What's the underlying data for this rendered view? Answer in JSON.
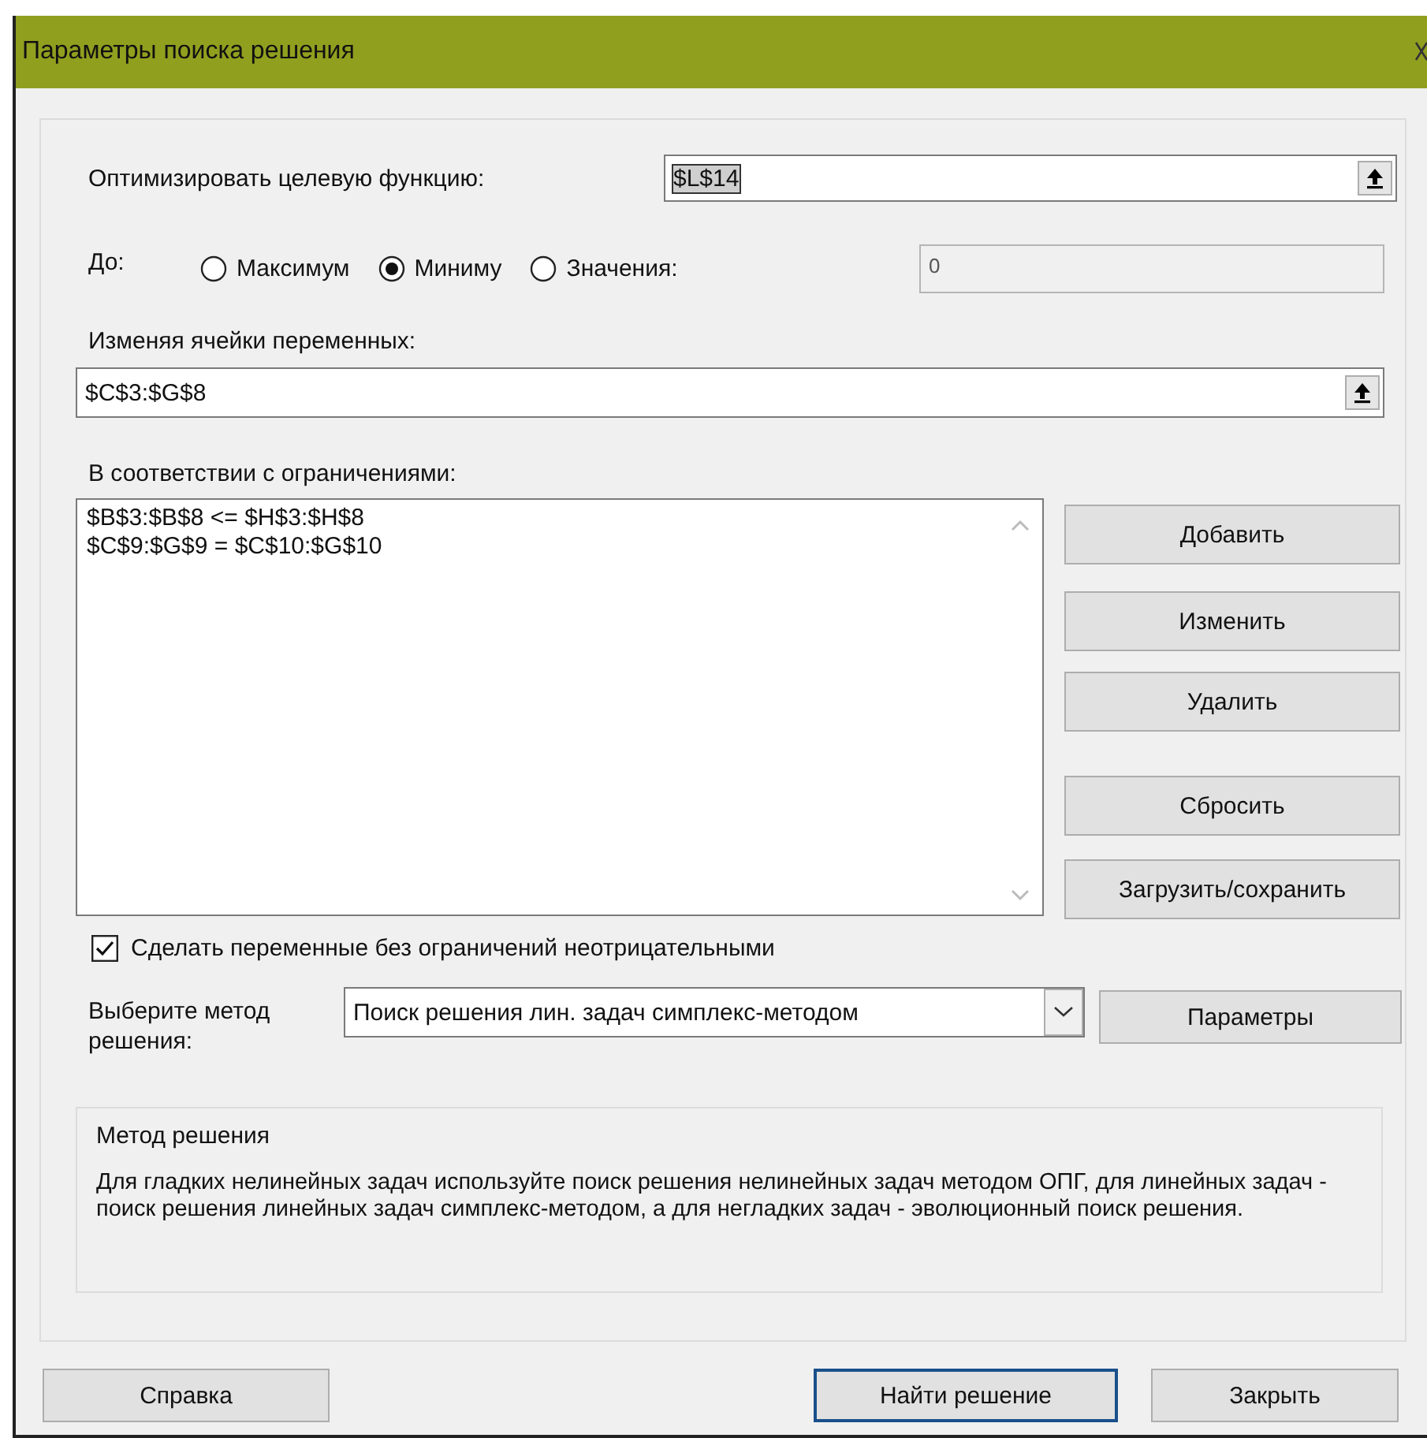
{
  "window": {
    "title": "Параметры поиска решения"
  },
  "objective": {
    "label": "Оптимизировать целевую функцию:",
    "value": "$L$14",
    "selected_text": true
  },
  "target": {
    "label": "До:",
    "options": [
      {
        "label": "Максимум",
        "selected": false
      },
      {
        "label": "Миниму",
        "selected": true
      },
      {
        "label": "Значения:",
        "selected": false
      }
    ],
    "value_field": {
      "value": "0",
      "disabled": true
    }
  },
  "variables": {
    "label": "Изменяя ячейки переменных:",
    "value": "$C$3:$G$8"
  },
  "constraints": {
    "label": "В соответствии с ограничениями:",
    "items": [
      "$B$3:$B$8 <= $H$3:$H$8",
      "$C$9:$G$9 = $C$10:$G$10"
    ]
  },
  "constraint_buttons": [
    {
      "label": "Добавить"
    },
    {
      "label": "Изменить"
    },
    {
      "label": "Удалить"
    },
    {
      "label": "Сбросить"
    },
    {
      "label": "Загрузить/сохранить"
    }
  ],
  "nonnegative": {
    "label": "Сделать переменные без ограничений неотрицательными",
    "checked": true
  },
  "method": {
    "label": "Выберите метод решения:",
    "value": "Поиск решения лин. задач симплекс-методом",
    "button": "Параметры"
  },
  "method_info": {
    "title": "Метод решения",
    "text": "Для гладких нелинейных задач используйте поиск решения нелинейных задач методом ОПГ, для линейных задач - поиск решения линейных задач симплекс-методом, а для негладких задач - эволюционный поиск решения."
  },
  "footer_buttons": [
    {
      "label": "Справка",
      "focused": false
    },
    {
      "label": "Найти решение",
      "focused": true
    },
    {
      "label": "Закрыть",
      "focused": false
    }
  ]
}
